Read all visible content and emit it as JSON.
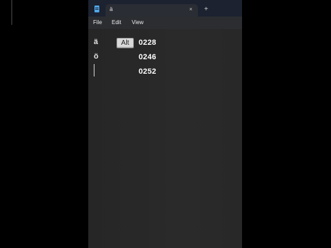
{
  "titlebar": {
    "app_icon": "notepad-icon",
    "tab_title": "ä",
    "close_glyph": "×",
    "new_tab_glyph": "+"
  },
  "menu": {
    "file": "File",
    "edit": "Edit",
    "view": "View"
  },
  "editor": {
    "lines": [
      "ä",
      "ö"
    ],
    "overlay": {
      "key_label": "Alt",
      "codes": [
        "0228",
        "0246",
        "0252"
      ]
    }
  },
  "colors": {
    "window_bg": "#272727",
    "titlebar_bg": "#1c2230",
    "accent": "#4fa6e8"
  }
}
